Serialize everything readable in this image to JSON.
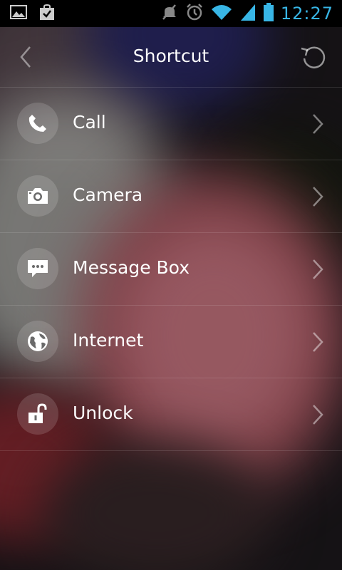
{
  "status_bar": {
    "time": "12:27",
    "icons": [
      "picture-icon",
      "shopping-bag-check-icon",
      "mute-icon",
      "alarm-icon",
      "wifi-icon",
      "signal-icon",
      "battery-icon"
    ]
  },
  "header": {
    "title": "Shortcut"
  },
  "shortcuts": [
    {
      "label": "Call",
      "icon": "phone-icon"
    },
    {
      "label": "Camera",
      "icon": "camera-icon"
    },
    {
      "label": "Message Box",
      "icon": "message-icon"
    },
    {
      "label": "Internet",
      "icon": "globe-icon"
    },
    {
      "label": "Unlock",
      "icon": "unlock-icon"
    }
  ],
  "colors": {
    "clock": "#38b6e6",
    "status_bar_bg": "#000000",
    "text": "#ffffff"
  }
}
